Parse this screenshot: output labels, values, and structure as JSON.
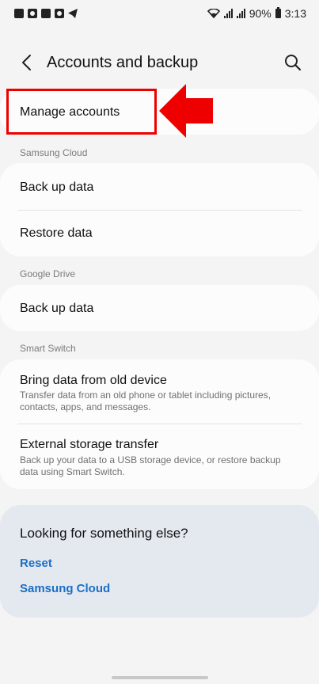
{
  "status_bar": {
    "battery": "90%",
    "time": "3:13",
    "left_icons": [
      "gallery-icon",
      "link-icon",
      "calendar-icon",
      "slack-icon",
      "telegram-icon"
    ]
  },
  "header": {
    "title": "Accounts and backup",
    "back_icon": "chevron-left-icon",
    "search_icon": "search-icon"
  },
  "manage_accounts": {
    "label": "Manage accounts"
  },
  "samsung_cloud": {
    "section_label": "Samsung Cloud",
    "items": [
      {
        "label": "Back up data"
      },
      {
        "label": "Restore data"
      }
    ]
  },
  "google_drive": {
    "section_label": "Google Drive",
    "items": [
      {
        "label": "Back up data"
      }
    ]
  },
  "smart_switch": {
    "section_label": "Smart Switch",
    "items": [
      {
        "label": "Bring data from old device",
        "description": "Transfer data from an old phone or tablet including pictures, contacts, apps, and messages."
      },
      {
        "label": "External storage transfer",
        "description": "Back up your data to a USB storage device, or restore backup data using Smart Switch."
      }
    ]
  },
  "suggestions": {
    "title": "Looking for something else?",
    "links": [
      {
        "label": "Reset"
      },
      {
        "label": "Samsung Cloud"
      }
    ]
  },
  "annotation": {
    "color": "#ee0000"
  },
  "colors": {
    "link": "#1a6fc6",
    "background": "#f4f4f4",
    "card": "#fcfcfc",
    "suggestion_bg": "#e4e8ef"
  }
}
